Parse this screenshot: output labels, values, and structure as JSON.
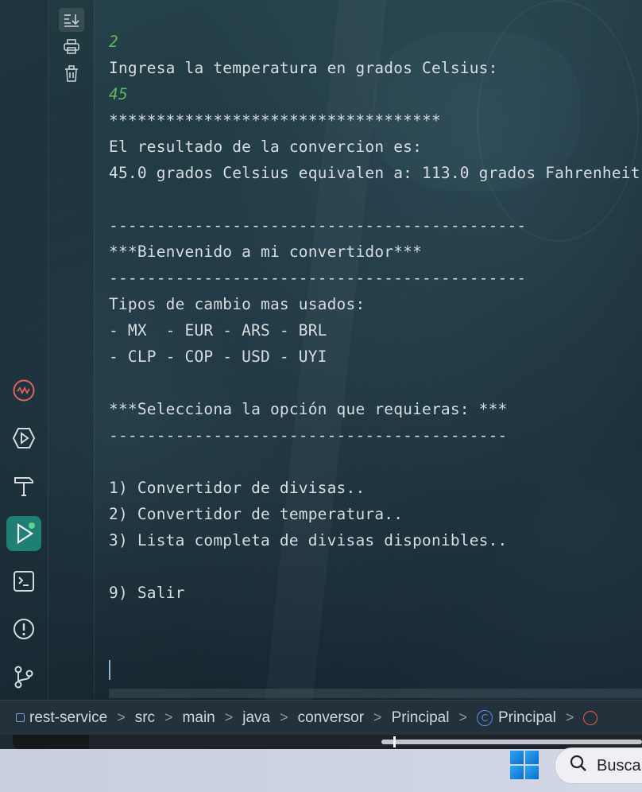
{
  "console": {
    "lines": [
      {
        "text": "2",
        "type": "input"
      },
      {
        "text": "Ingresa la temperatura en grados Celsius:",
        "type": "output"
      },
      {
        "text": "45",
        "type": "input"
      },
      {
        "text": "***********************************",
        "type": "output"
      },
      {
        "text": "El resultado de la convercion es:",
        "type": "output"
      },
      {
        "text": "45.0 grados Celsius equivalen a: 113.0 grados Fahrenheit",
        "type": "output"
      },
      {
        "text": "",
        "type": "output"
      },
      {
        "text": "--------------------------------------------",
        "type": "output"
      },
      {
        "text": "***Bienvenido a mi convertidor***",
        "type": "output"
      },
      {
        "text": "--------------------------------------------",
        "type": "output"
      },
      {
        "text": "Tipos de cambio mas usados:",
        "type": "output"
      },
      {
        "text": "- MX  - EUR - ARS - BRL",
        "type": "output"
      },
      {
        "text": "- CLP - COP - USD - UYI",
        "type": "output"
      },
      {
        "text": "",
        "type": "output"
      },
      {
        "text": "***Selecciona la opción que requieras: ***",
        "type": "output"
      },
      {
        "text": "------------------------------------------",
        "type": "output"
      },
      {
        "text": "",
        "type": "output"
      },
      {
        "text": "1) Convertidor de divisas..",
        "type": "output"
      },
      {
        "text": "2) Convertidor de temperatura..",
        "type": "output"
      },
      {
        "text": "3) Lista completa de divisas disponibles..",
        "type": "output"
      },
      {
        "text": "",
        "type": "output"
      },
      {
        "text": "9) Salir",
        "type": "output"
      }
    ]
  },
  "console_actions": [
    {
      "name": "scroll-to-end-icon"
    },
    {
      "name": "print-icon"
    },
    {
      "name": "trash-icon"
    }
  ],
  "tools": [
    {
      "name": "profiler-icon"
    },
    {
      "name": "services-icon"
    },
    {
      "name": "build-icon"
    },
    {
      "name": "run-icon"
    },
    {
      "name": "terminal-icon"
    },
    {
      "name": "problems-icon"
    },
    {
      "name": "git-icon"
    }
  ],
  "breadcrumb": {
    "items": [
      "rest-service",
      "src",
      "main",
      "java",
      "conversor",
      "Principal",
      "Principal"
    ],
    "separator": ">"
  },
  "taskbar": {
    "search_label": "Busca"
  },
  "colors": {
    "input_text": "#5fb55f",
    "output_text": "#d6dde0",
    "run_active": "#1f7f74",
    "class_icon": "#4c8ee8"
  }
}
